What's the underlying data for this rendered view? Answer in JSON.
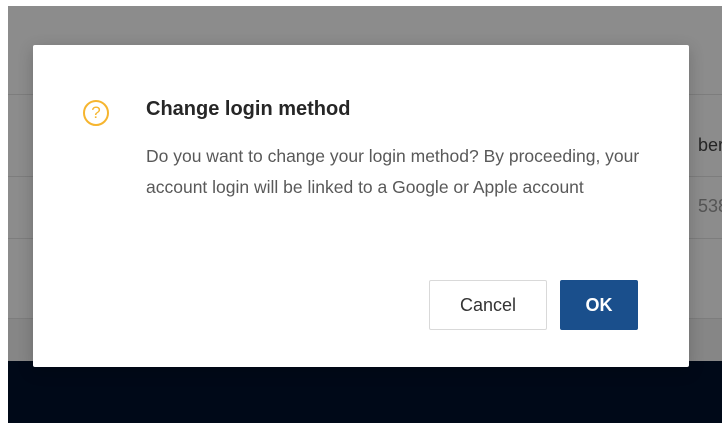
{
  "background": {
    "row1_partial_text": "berl",
    "row2_partial_text": "538"
  },
  "dialog": {
    "icon": "question-circle-icon",
    "icon_glyph": "?",
    "icon_color": "#f6b52f",
    "title": "Change login method",
    "message": "Do you want to change your login method? By proceeding, your account login will be linked to a Google or Apple account",
    "cancel_label": "Cancel",
    "ok_label": "OK",
    "ok_color": "#1a4f8c"
  },
  "colors": {
    "footer": "#00112c",
    "overlay": "rgba(0,0,0,0.45)"
  }
}
